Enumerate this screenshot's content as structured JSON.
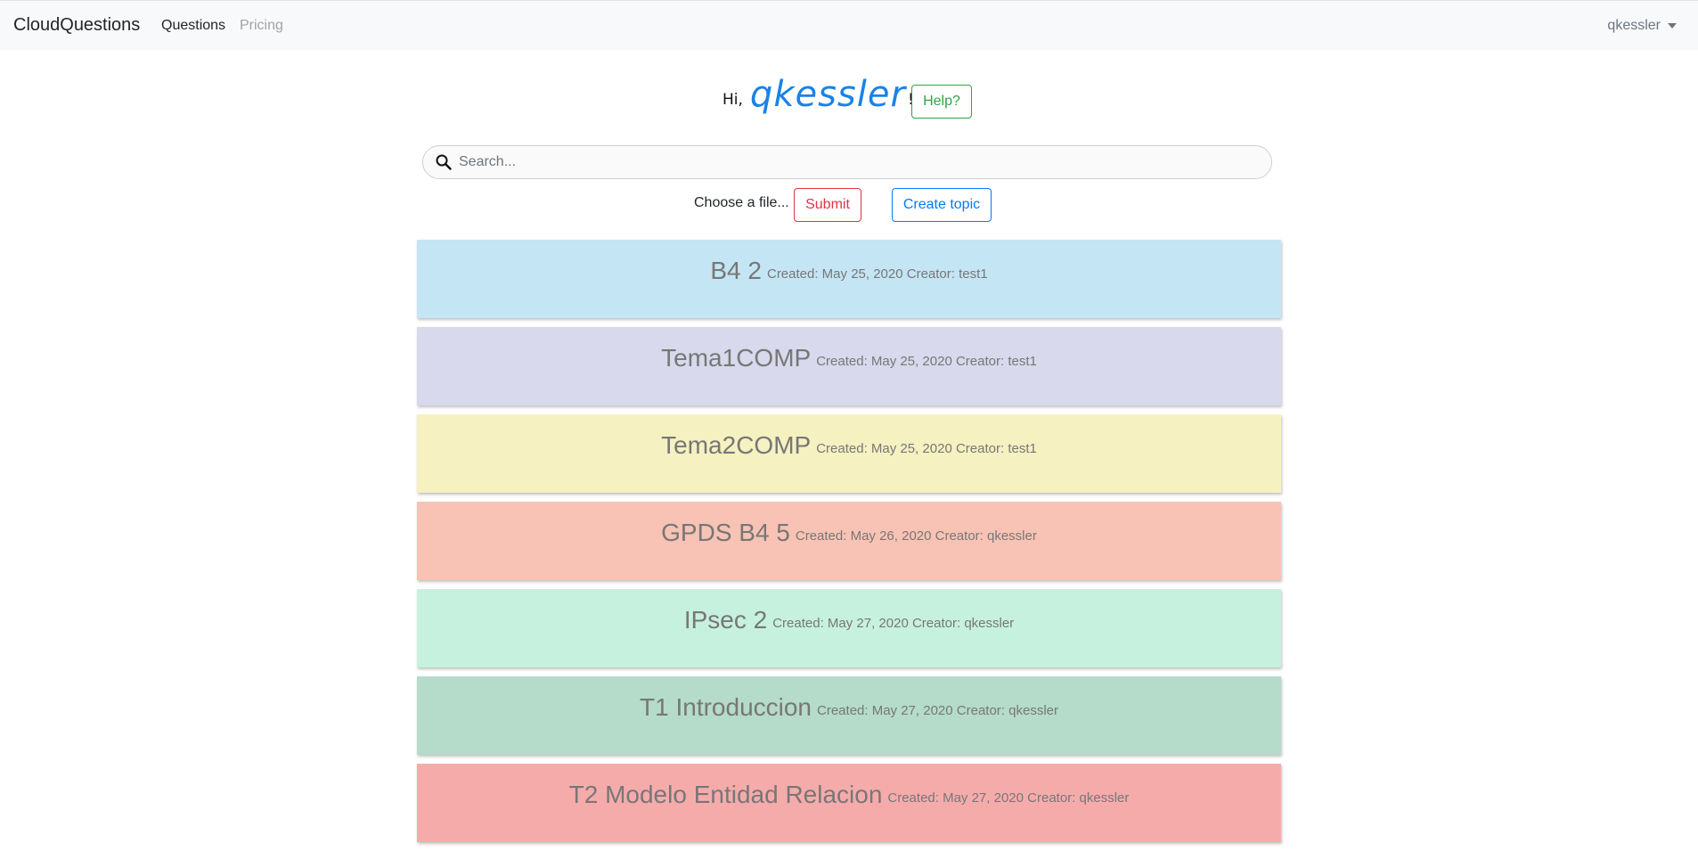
{
  "navbar": {
    "brand": "CloudQuestions",
    "links": [
      "Questions",
      "Pricing"
    ],
    "user": "qkessler"
  },
  "greeting": {
    "hi": "Hi,",
    "name": "qkessler",
    "bang": "!",
    "help_label": "Help?"
  },
  "search": {
    "placeholder": "Search...",
    "value": ""
  },
  "actions": {
    "file_label": "Choose a file...",
    "submit_label": "Submit",
    "create_label": "Create topic"
  },
  "colors": {
    "accent_blue": "#007bff",
    "help_green": "#28a745",
    "submit_red": "#dc3545"
  },
  "topics": [
    {
      "title": "B4 2",
      "meta": "Created: May 25, 2020 Creator: test1",
      "color": "#c4e5f4"
    },
    {
      "title": "Tema1COMP",
      "meta": "Created: May 25, 2020 Creator: test1",
      "color": "#d8d9ec"
    },
    {
      "title": "Tema2COMP",
      "meta": "Created: May 25, 2020 Creator: test1",
      "color": "#f5f1c0"
    },
    {
      "title": "GPDS B4 5",
      "meta": "Created: May 26, 2020 Creator: qkessler",
      "color": "#f8c3b4"
    },
    {
      "title": "IPsec 2",
      "meta": "Created: May 27, 2020 Creator: qkessler",
      "color": "#c6f1df"
    },
    {
      "title": "T1 Introduccion",
      "meta": "Created: May 27, 2020 Creator: qkessler",
      "color": "#b5dbca"
    },
    {
      "title": "T2 Modelo Entidad Relacion",
      "meta": "Created: May 27, 2020 Creator: qkessler",
      "color": "#f6abab"
    }
  ]
}
